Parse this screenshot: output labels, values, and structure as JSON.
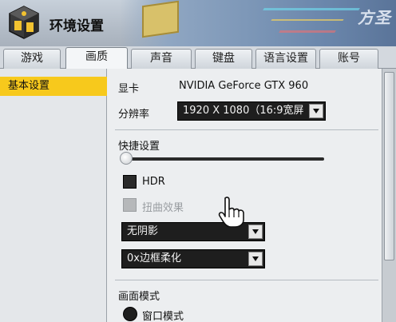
{
  "window": {
    "title": "环境设置",
    "header_logo_text": "方圣"
  },
  "tabs": [
    {
      "label": "游戏"
    },
    {
      "label": "画质"
    },
    {
      "label": "声音"
    },
    {
      "label": "键盘"
    },
    {
      "label": "语言设置"
    },
    {
      "label": "账号"
    }
  ],
  "active_tab": "画质",
  "sidebar": {
    "items": [
      {
        "label": "基本设置"
      }
    ]
  },
  "graphics": {
    "gpu_label": "显卡",
    "gpu_value": "NVIDIA GeForce GTX 960",
    "resolution_label": "分辨率",
    "resolution_value": "1920 X 1080（16:9宽屏",
    "quick_settings_label": "快捷设置",
    "quick_settings_level": 0,
    "hdr_label": "HDR",
    "distortion_label": "扭曲效果",
    "shadow_value": "无阴影",
    "antialias_value": "0x边框柔化",
    "display_mode_label": "画面模式",
    "window_mode_label": "窗口模式"
  },
  "colors": {
    "accent": "#f7c91c",
    "panel": "#eceef0",
    "dropdown_bg": "#1e1e1e"
  },
  "icons": {
    "app": "settings-cube-icon",
    "dropdown": "chevron-down-icon",
    "cursor": "hand-pointer-icon"
  }
}
